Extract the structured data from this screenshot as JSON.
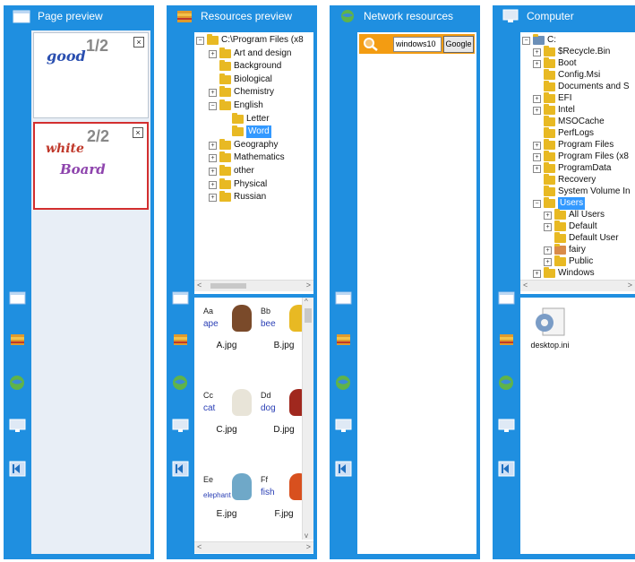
{
  "panels": {
    "page_preview": {
      "title": "Page preview",
      "pages": [
        {
          "number": "1/2",
          "content": "good"
        },
        {
          "number": "2/2",
          "content_line1": "white",
          "content_line2": "Board"
        }
      ],
      "close_glyph": "×"
    },
    "resources_preview": {
      "title": "Resources preview",
      "tree": [
        {
          "label": "C:\\Program Files (x8",
          "level": 0,
          "expander": "−"
        },
        {
          "label": "Art and design",
          "level": 1,
          "expander": "+"
        },
        {
          "label": "Background",
          "level": 1,
          "expander": ""
        },
        {
          "label": "Biological",
          "level": 1,
          "expander": ""
        },
        {
          "label": "Chemistry",
          "level": 1,
          "expander": "+"
        },
        {
          "label": "English",
          "level": 1,
          "expander": "−"
        },
        {
          "label": "Letter",
          "level": 2,
          "expander": ""
        },
        {
          "label": "Word",
          "level": 2,
          "expander": "",
          "selected": true
        },
        {
          "label": "Geography",
          "level": 1,
          "expander": "+"
        },
        {
          "label": "Mathematics",
          "level": 1,
          "expander": "+"
        },
        {
          "label": "other",
          "level": 1,
          "expander": "+"
        },
        {
          "label": "Physical",
          "level": 1,
          "expander": "+"
        },
        {
          "label": "Russian",
          "level": 1,
          "expander": "+"
        }
      ],
      "files": [
        {
          "name": "A.jpg",
          "letter": "Aa",
          "word": "ape"
        },
        {
          "name": "B.jpg",
          "letter": "Bb",
          "word": "bee"
        },
        {
          "name": "C.jpg",
          "letter": "Cc",
          "word": "cat"
        },
        {
          "name": "D.jpg",
          "letter": "Dd",
          "word": "dog"
        },
        {
          "name": "E.jpg",
          "letter": "Ee",
          "word": "elephant"
        },
        {
          "name": "F.jpg",
          "letter": "Ff",
          "word": "fish"
        }
      ]
    },
    "network_resources": {
      "title": "Network resources",
      "search_value": "windows10",
      "search_button": "Google"
    },
    "computer": {
      "title": "Computer",
      "tree": [
        {
          "label": "C:",
          "level": 0,
          "expander": "−",
          "drive": true
        },
        {
          "label": "$Recycle.Bin",
          "level": 1,
          "expander": "+"
        },
        {
          "label": "Boot",
          "level": 1,
          "expander": "+"
        },
        {
          "label": "Config.Msi",
          "level": 1,
          "expander": ""
        },
        {
          "label": "Documents and S",
          "level": 1,
          "expander": ""
        },
        {
          "label": "EFI",
          "level": 1,
          "expander": "+"
        },
        {
          "label": "Intel",
          "level": 1,
          "expander": "+"
        },
        {
          "label": "MSOCache",
          "level": 1,
          "expander": ""
        },
        {
          "label": "PerfLogs",
          "level": 1,
          "expander": ""
        },
        {
          "label": "Program Files",
          "level": 1,
          "expander": "+"
        },
        {
          "label": "Program Files (x8",
          "level": 1,
          "expander": "+"
        },
        {
          "label": "ProgramData",
          "level": 1,
          "expander": "+"
        },
        {
          "label": "Recovery",
          "level": 1,
          "expander": ""
        },
        {
          "label": "System Volume In",
          "level": 1,
          "expander": ""
        },
        {
          "label": "Users",
          "level": 1,
          "expander": "−",
          "selected": true
        },
        {
          "label": "All Users",
          "level": 2,
          "expander": "+"
        },
        {
          "label": "Default",
          "level": 2,
          "expander": "+"
        },
        {
          "label": "Default User",
          "level": 2,
          "expander": ""
        },
        {
          "label": "fairy",
          "level": 2,
          "expander": "+",
          "user": true
        },
        {
          "label": "Public",
          "level": 2,
          "expander": "+"
        },
        {
          "label": "Windows",
          "level": 1,
          "expander": "+"
        }
      ],
      "file": {
        "name": "desktop.ini"
      }
    }
  },
  "rail_icons": [
    "page-preview-icon",
    "resources-icon",
    "network-globe-icon",
    "computer-monitor-icon",
    "collapse-panel-icon"
  ],
  "scroll_arrows": {
    "left": "<",
    "right": ">",
    "up": "^",
    "down": "v"
  },
  "colors": {
    "panel_blue": "#1f8fe0",
    "selection": "#3399ff",
    "folder": "#e8b923",
    "selected_border": "#d32f2f"
  }
}
